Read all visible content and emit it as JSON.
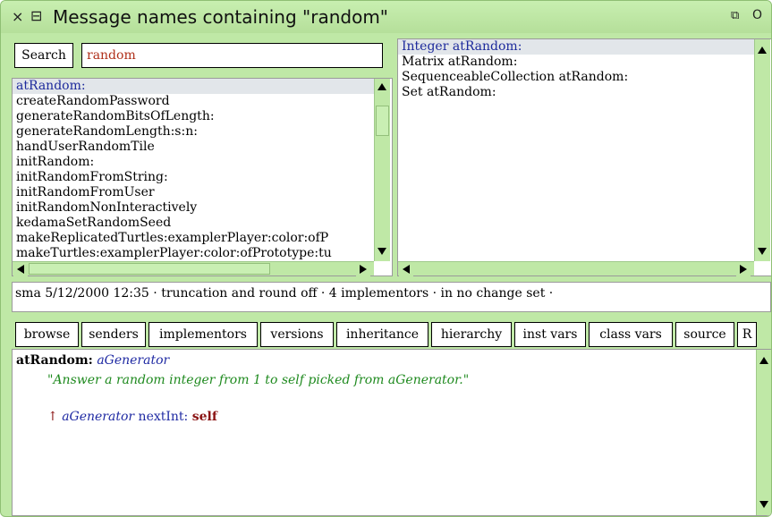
{
  "window": {
    "title": "Message names containing \"random\"",
    "close_glyph": "×",
    "menu_glyph": "⊟",
    "collapse_glyph": "⧉",
    "expand_glyph": "O"
  },
  "search": {
    "button_label": "Search",
    "query": "random"
  },
  "selectors": {
    "selected_index": 0,
    "items": [
      "atRandom:",
      "createRandomPassword",
      "generateRandomBitsOfLength:",
      "generateRandomLength:s:n:",
      "handUserRandomTile",
      "initRandom:",
      "initRandomFromString:",
      "initRandomFromUser",
      "initRandomNonInteractively",
      "kedamaSetRandomSeed",
      "makeReplicatedTurtles:examplerPlayer:color:ofP",
      "makeTurtles:examplerPlayer:color:ofPrototype:tu"
    ]
  },
  "implementors": {
    "selected_index": 0,
    "items": [
      "Integer atRandom:",
      "Matrix atRandom:",
      "SequenceableCollection atRandom:",
      "Set atRandom:"
    ]
  },
  "info_line": "sma 5/12/2000 12:35 · truncation and round off · 4 implementors · in no change set ·",
  "toolbar": {
    "buttons": [
      "browse",
      "senders",
      "implementors",
      "versions",
      "inheritance",
      "hierarchy",
      "inst vars",
      "class vars",
      "source",
      "R"
    ]
  },
  "code": {
    "selector": "atRandom:",
    "argument": "aGenerator",
    "comment": "\"Answer a random integer from 1 to self picked from aGenerator.\"",
    "return_caret": "↑",
    "body_receiver": "aGenerator",
    "body_message": "nextInt:",
    "body_argument": "self"
  },
  "colors": {
    "window_bg": "#bfe8a6",
    "selection_bg": "#e2e6ea",
    "selection_text": "#1d2a9c",
    "search_text": "#b0301a",
    "comment": "#1f8a1f",
    "argument": "#1f2aa3",
    "self": "#8a1212"
  }
}
